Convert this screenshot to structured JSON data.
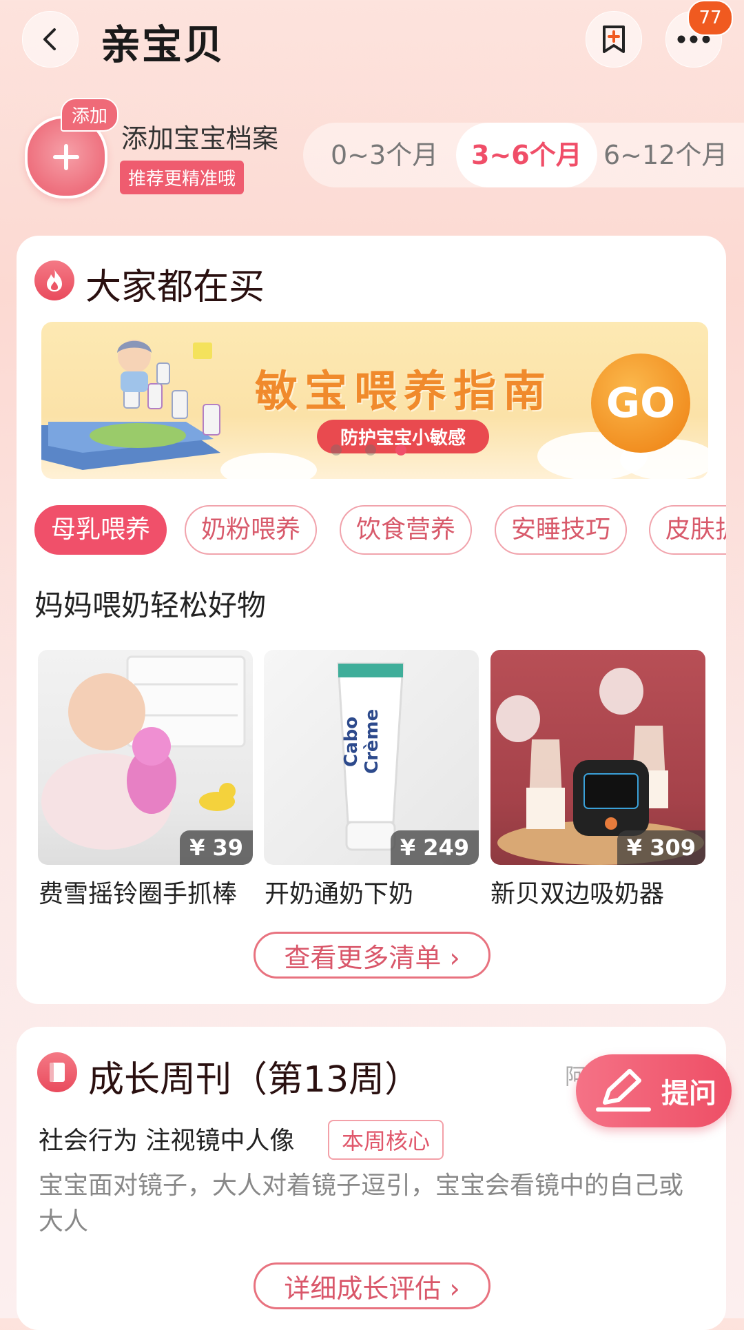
{
  "header": {
    "title": "亲宝贝",
    "badge_count": "77"
  },
  "profile": {
    "add_tag": "添加",
    "title": "添加宝宝档案",
    "tip": "推荐更精准哦",
    "age_tabs": [
      "0~3个月",
      "3~6个月",
      "6~12个月"
    ],
    "active_age": "3~6个月"
  },
  "hot": {
    "title": "大家都在买",
    "banner": {
      "title": "敏宝喂养指南",
      "subtitle": "防护宝宝小敏感",
      "go": "GO"
    },
    "chips": [
      "母乳喂养",
      "奶粉喂养",
      "饮食营养",
      "安睡技巧",
      "皮肤护"
    ],
    "active_chip": "母乳喂养",
    "list_title": "妈妈喂奶轻松好物",
    "products": [
      {
        "name": "费雪摇铃圈手抓棒",
        "price": "¥ 39"
      },
      {
        "name": "开奶通奶下奶",
        "price": "¥ 249"
      },
      {
        "name": "新贝双边吸奶器",
        "price": "¥ 309"
      }
    ],
    "more_label": "查看更多清单 ›"
  },
  "growth": {
    "title": "成长周刊（第13周）",
    "side_label": "阿",
    "item_title": "社会行为 注视镜中人像",
    "item_tag": "本周核心",
    "description": "宝宝面对镜子，大人对着镜子逗引，宝宝会看镜中的自己或大人",
    "detail_label": "详细成长评估 ›"
  },
  "floating": {
    "ask_label": "提问"
  },
  "colors": {
    "accent": "#f0506a",
    "badge": "#f05a20",
    "banner_go": "#f08a1c"
  }
}
